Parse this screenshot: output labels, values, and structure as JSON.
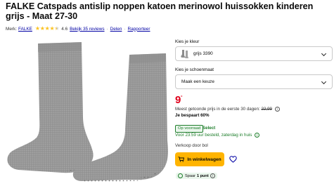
{
  "product": {
    "title": "FALKE Catspads antislip noppen katoen merinowol huissokken kinderen grijs - Maat 27-30",
    "brand_label": "Merk:",
    "brand": "FALKE",
    "rating": "4.6",
    "reviews_link": "Bekijk 35 reviews",
    "share_link": "Delen",
    "report_link": "Rapporteer"
  },
  "color_select": {
    "label": "Kies je kleur",
    "value": "grijs 3390"
  },
  "size_select": {
    "label": "Kies je schoenmaat",
    "value": "Maak een keuze"
  },
  "pricing": {
    "price_main": "9",
    "price_cents": "-",
    "lowest_price_note": "Meest getoonde prijs in de eerste 30 dagen:",
    "old_price": "22,99",
    "savings": "Je bespaart 60%"
  },
  "delivery": {
    "in_stock_badge": "Op voorraad",
    "select_label": "Select",
    "delivery_note": "Voor 23:59 uur besteld, zaterdag in huis",
    "seller": "Verkoop door bol"
  },
  "actions": {
    "cart_button": "In winkelwagen",
    "spaar_label": "Spaar",
    "spaar_points": "1 punt"
  },
  "colors": {
    "price_red": "#e0001b",
    "link_blue": "#0000a4",
    "cart_yellow": "#ffb400",
    "stock_green": "#1d7d2a",
    "star_yellow": "#fbc21f"
  }
}
